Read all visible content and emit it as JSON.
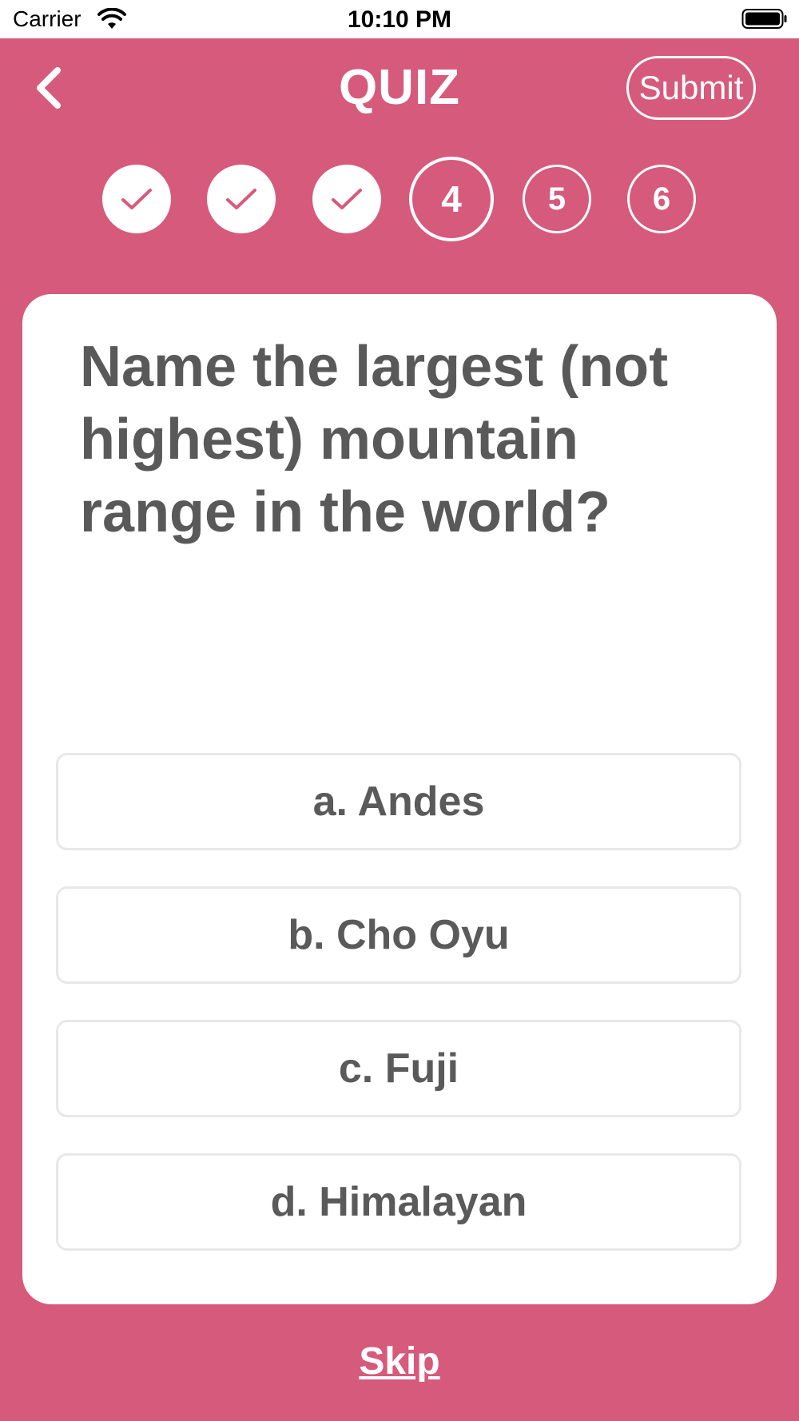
{
  "status_bar": {
    "carrier": "Carrier",
    "time": "10:10 PM",
    "wifi_icon": "wifi-icon",
    "battery_icon": "battery-icon"
  },
  "header": {
    "title": "QUIZ",
    "submit_label": "Submit",
    "back_icon": "chevron-left-icon"
  },
  "progress": {
    "steps": [
      {
        "label": "",
        "state": "done"
      },
      {
        "label": "",
        "state": "done"
      },
      {
        "label": "",
        "state": "done"
      },
      {
        "label": "4",
        "state": "current"
      },
      {
        "label": "5",
        "state": "todo"
      },
      {
        "label": "6",
        "state": "todo"
      }
    ]
  },
  "question": {
    "text": "Name the largest (not highest) mountain range in the world?"
  },
  "options": [
    {
      "label": "a. Andes"
    },
    {
      "label": "b. Cho Oyu"
    },
    {
      "label": "c. Fuji"
    },
    {
      "label": "d. Himalayan"
    }
  ],
  "footer": {
    "skip_label": "Skip"
  },
  "colors": {
    "accent": "#d65a7b",
    "card": "#ffffff",
    "text": "#595959"
  }
}
